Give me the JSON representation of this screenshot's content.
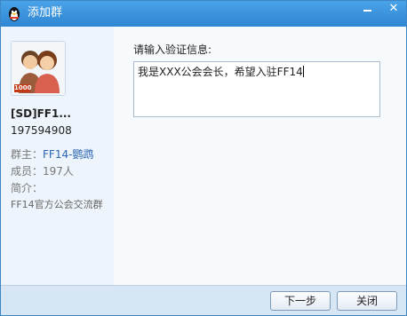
{
  "window": {
    "title": "添加群",
    "minimize_icon": "minimize-icon",
    "close_icon": "close-icon"
  },
  "group": {
    "badge": "1000",
    "name": "[SD]FF1...",
    "id": "197594908",
    "owner_label": "群主：",
    "owner_value": "FF14-鹦鹉",
    "members_label": "成员：",
    "members_value": "197人",
    "intro_label": "简介：",
    "intro_text": "FF14官方公会交流群"
  },
  "form": {
    "prompt": "请输入验证信息:",
    "message": "我是XXX公会会长，希望入驻FF14"
  },
  "buttons": {
    "next": "下一步",
    "close": "关闭"
  },
  "colors": {
    "titlebar": "#3a93de",
    "link": "#2a64b3",
    "panel": "#eef4fb"
  }
}
